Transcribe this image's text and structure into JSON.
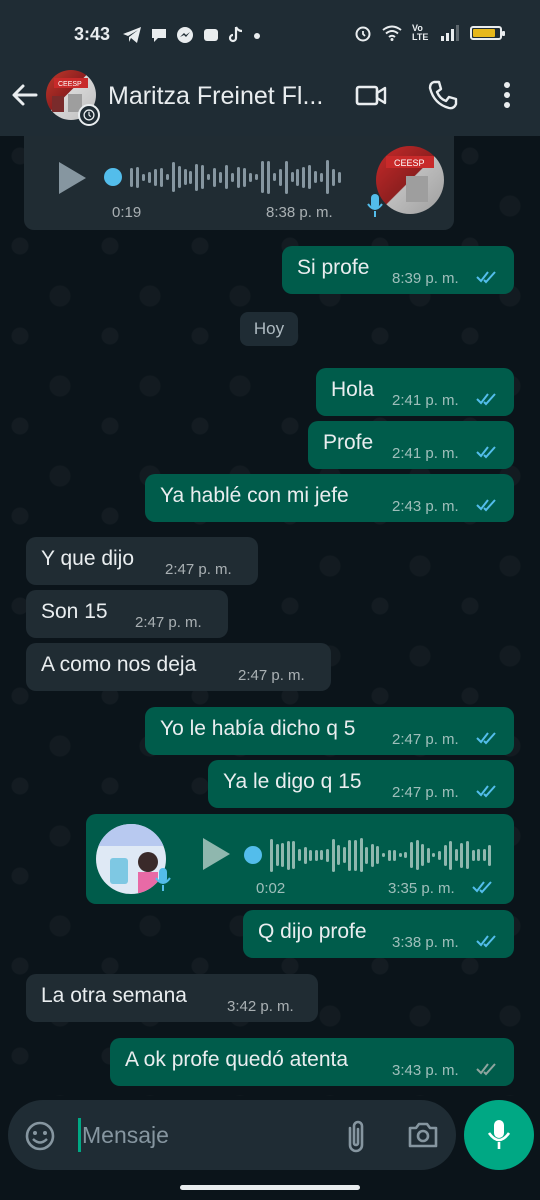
{
  "status_bar": {
    "time": "3:43",
    "network_label": "Vo LTE",
    "battery_level": 0.85,
    "battery_color": "#e6b81b",
    "notification_icons": [
      "telegram-icon",
      "chat-bubble-icon",
      "messenger-icon",
      "photo-icon",
      "tiktok-icon",
      "dot-icon"
    ],
    "system_icons": [
      "alarm-icon",
      "wifi-icon",
      "volte-icon",
      "signal-icon",
      "battery-icon"
    ]
  },
  "header": {
    "title": "Maritza Freinet Fl...",
    "icons": [
      "back-arrow-icon",
      "video-call-icon",
      "phone-icon",
      "more-vert-icon"
    ]
  },
  "colors": {
    "background": "#0b141a",
    "header": "#1f2c34",
    "outgoing_bubble": "#005c4b",
    "incoming_bubble": "#202c33",
    "accent": "#00a884",
    "read_ticks": "#53bdeb"
  },
  "messages": [
    {
      "type": "voice",
      "direction": "in",
      "duration": "0:19",
      "time": "8:38 p. m.",
      "icon": "mic-icon",
      "progress": 0
    },
    {
      "type": "text",
      "direction": "out",
      "text": "Si profe",
      "time": "8:39 p. m.",
      "status": "read"
    },
    {
      "type": "date",
      "text": "Hoy"
    },
    {
      "type": "text",
      "direction": "out",
      "text": "Hola",
      "time": "2:41 p. m.",
      "status": "read"
    },
    {
      "type": "text",
      "direction": "out",
      "text": "Profe",
      "time": "2:41 p. m.",
      "status": "read"
    },
    {
      "type": "text",
      "direction": "out",
      "text": "Ya hablé con mi  jefe",
      "time": "2:43 p. m.",
      "status": "read"
    },
    {
      "type": "text",
      "direction": "in",
      "text": "Y que dijo",
      "time": "2:47 p. m."
    },
    {
      "type": "text",
      "direction": "in",
      "text": "Son 15",
      "time": "2:47 p. m."
    },
    {
      "type": "text",
      "direction": "in",
      "text": "A como nos deja",
      "time": "2:47 p. m."
    },
    {
      "type": "text",
      "direction": "out",
      "text": "Yo le había dicho q 5",
      "time": "2:47 p. m.",
      "status": "read"
    },
    {
      "type": "text",
      "direction": "out",
      "text": "Ya le digo q 15",
      "time": "2:47 p. m.",
      "status": "read"
    },
    {
      "type": "voice",
      "direction": "out",
      "duration": "0:02",
      "time": "3:35 p. m.",
      "status": "read",
      "icon": "mic-icon",
      "progress": 0
    },
    {
      "type": "text",
      "direction": "out",
      "text": "Q dijo profe",
      "time": "3:38 p. m.",
      "status": "read"
    },
    {
      "type": "text",
      "direction": "in",
      "text": "La otra semana",
      "time": "3:42 p. m."
    },
    {
      "type": "text",
      "direction": "out",
      "text": "A ok profe quedó atenta",
      "time": "3:43 p. m.",
      "status": "delivered"
    }
  ],
  "composer": {
    "placeholder": "Mensaje",
    "icons": [
      "emoji-icon",
      "attach-icon",
      "camera-icon",
      "mic-icon"
    ]
  }
}
